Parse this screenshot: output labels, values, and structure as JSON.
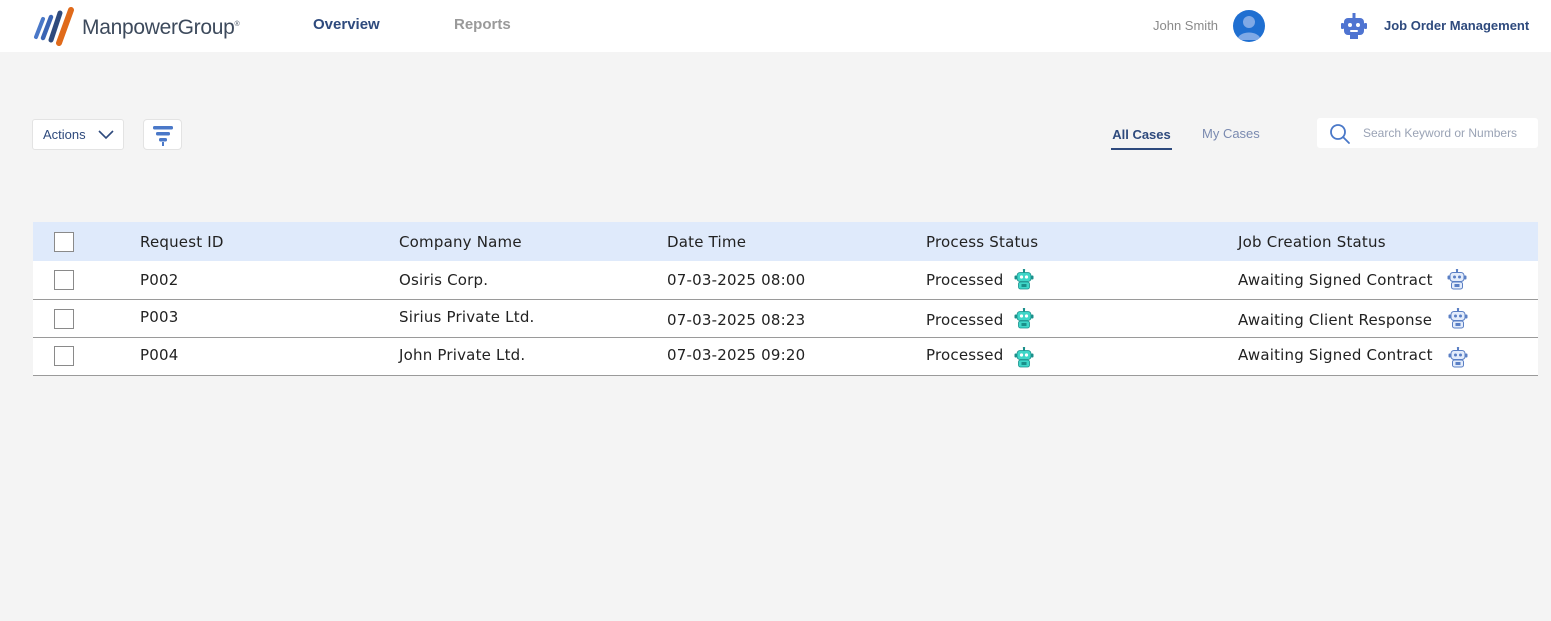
{
  "brand": {
    "name": "ManpowerGroup",
    "reg_mark": "®"
  },
  "nav": {
    "overview": "Overview",
    "reports": "Reports"
  },
  "user": {
    "name": "John Smith"
  },
  "app": {
    "name": "Job Order Management"
  },
  "toolbar": {
    "actions_label": "Actions"
  },
  "tabs": {
    "all": "All Cases",
    "my": "My Cases"
  },
  "search": {
    "placeholder": "Search Keyword or Numbers"
  },
  "table": {
    "headers": {
      "request_id": "Request ID",
      "company": "Company Name",
      "date": "Date Time",
      "process": "Process Status",
      "job": "Job Creation Status"
    },
    "rows": [
      {
        "request_id": "P002",
        "company": "Osiris Corp.",
        "date": "07-03-2025 08:00",
        "process": "Processed",
        "job": "Awaiting Signed Contract"
      },
      {
        "request_id": "P003",
        "company": "Sirius Private Ltd.",
        "date": "07-03-2025 08:23",
        "process": "Processed",
        "job": "Awaiting Client Response"
      },
      {
        "request_id": "P004",
        "company": "John Private Ltd.",
        "date": "07-03-2025 09:20",
        "process": "Processed",
        "job": "Awaiting Signed Contract"
      }
    ]
  },
  "colors": {
    "accent": "#2e4a7d",
    "header_row": "#dfeafb",
    "processed": "#1db84f",
    "awaiting": "#e8a21b"
  },
  "icons": [
    "brand-logo-icon",
    "user-avatar-icon",
    "bot-icon",
    "chevron-down-icon",
    "filter-icon",
    "search-icon",
    "process-bot-icon",
    "job-bot-icon"
  ]
}
